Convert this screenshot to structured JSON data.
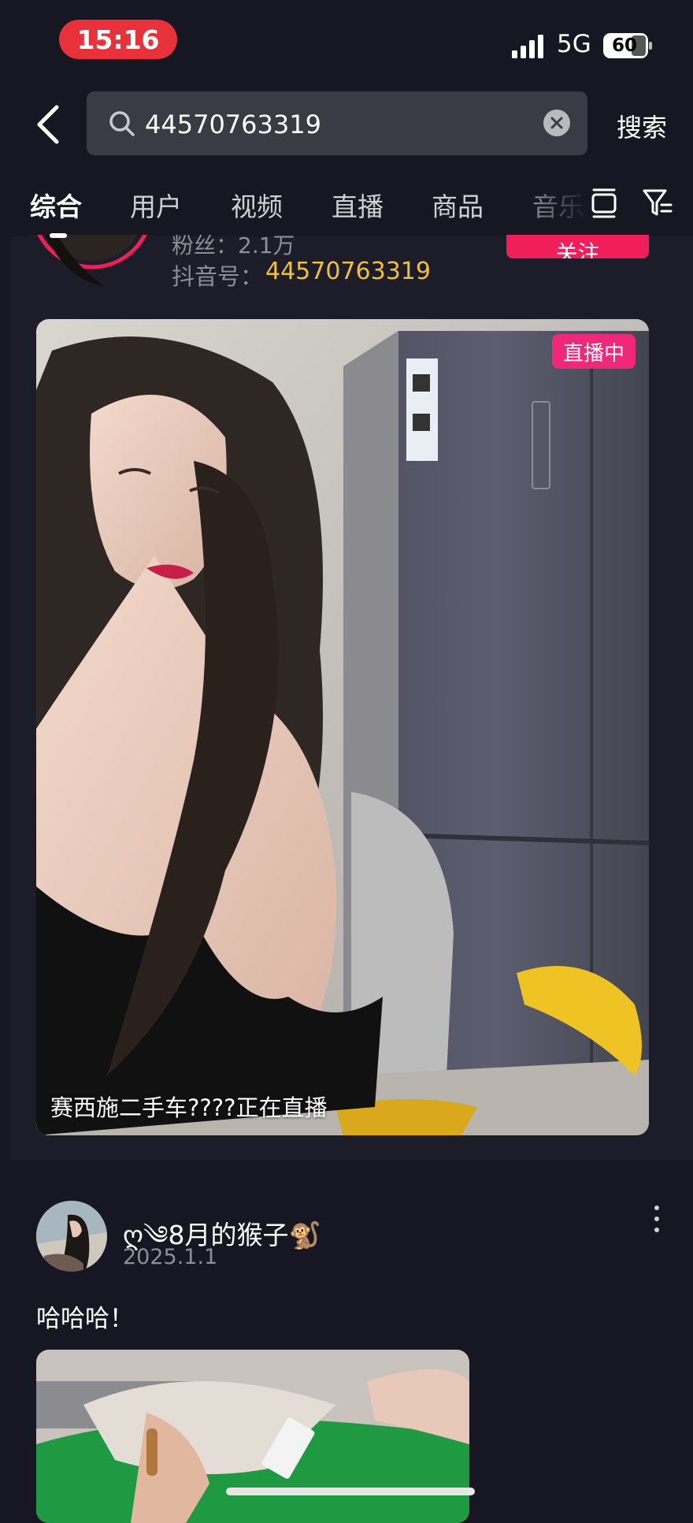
{
  "status_bar": {
    "time": "15:16",
    "network": "5G",
    "battery": "60"
  },
  "search": {
    "query": "44570763319",
    "submit_label": "搜索"
  },
  "tabs": [
    "综合",
    "用户",
    "视频",
    "直播",
    "商品",
    "音乐"
  ],
  "user_result": {
    "followers_text": "粉丝：2.1万",
    "id_label": "抖音号：",
    "id_value": "44570763319",
    "follow_label": "关注"
  },
  "live_card": {
    "badge": "直播中",
    "caption": "赛西施二手车????正在直播"
  },
  "post": {
    "author": "ღ༄8月的猴子🐒",
    "date": "2025.1.1",
    "text": "哈哈哈！"
  },
  "colors": {
    "background": "#161722",
    "card": "#1c1d28",
    "accent_red": "#f01f59",
    "live_pink": "#f0287a",
    "id_yellow": "#f2c037"
  }
}
